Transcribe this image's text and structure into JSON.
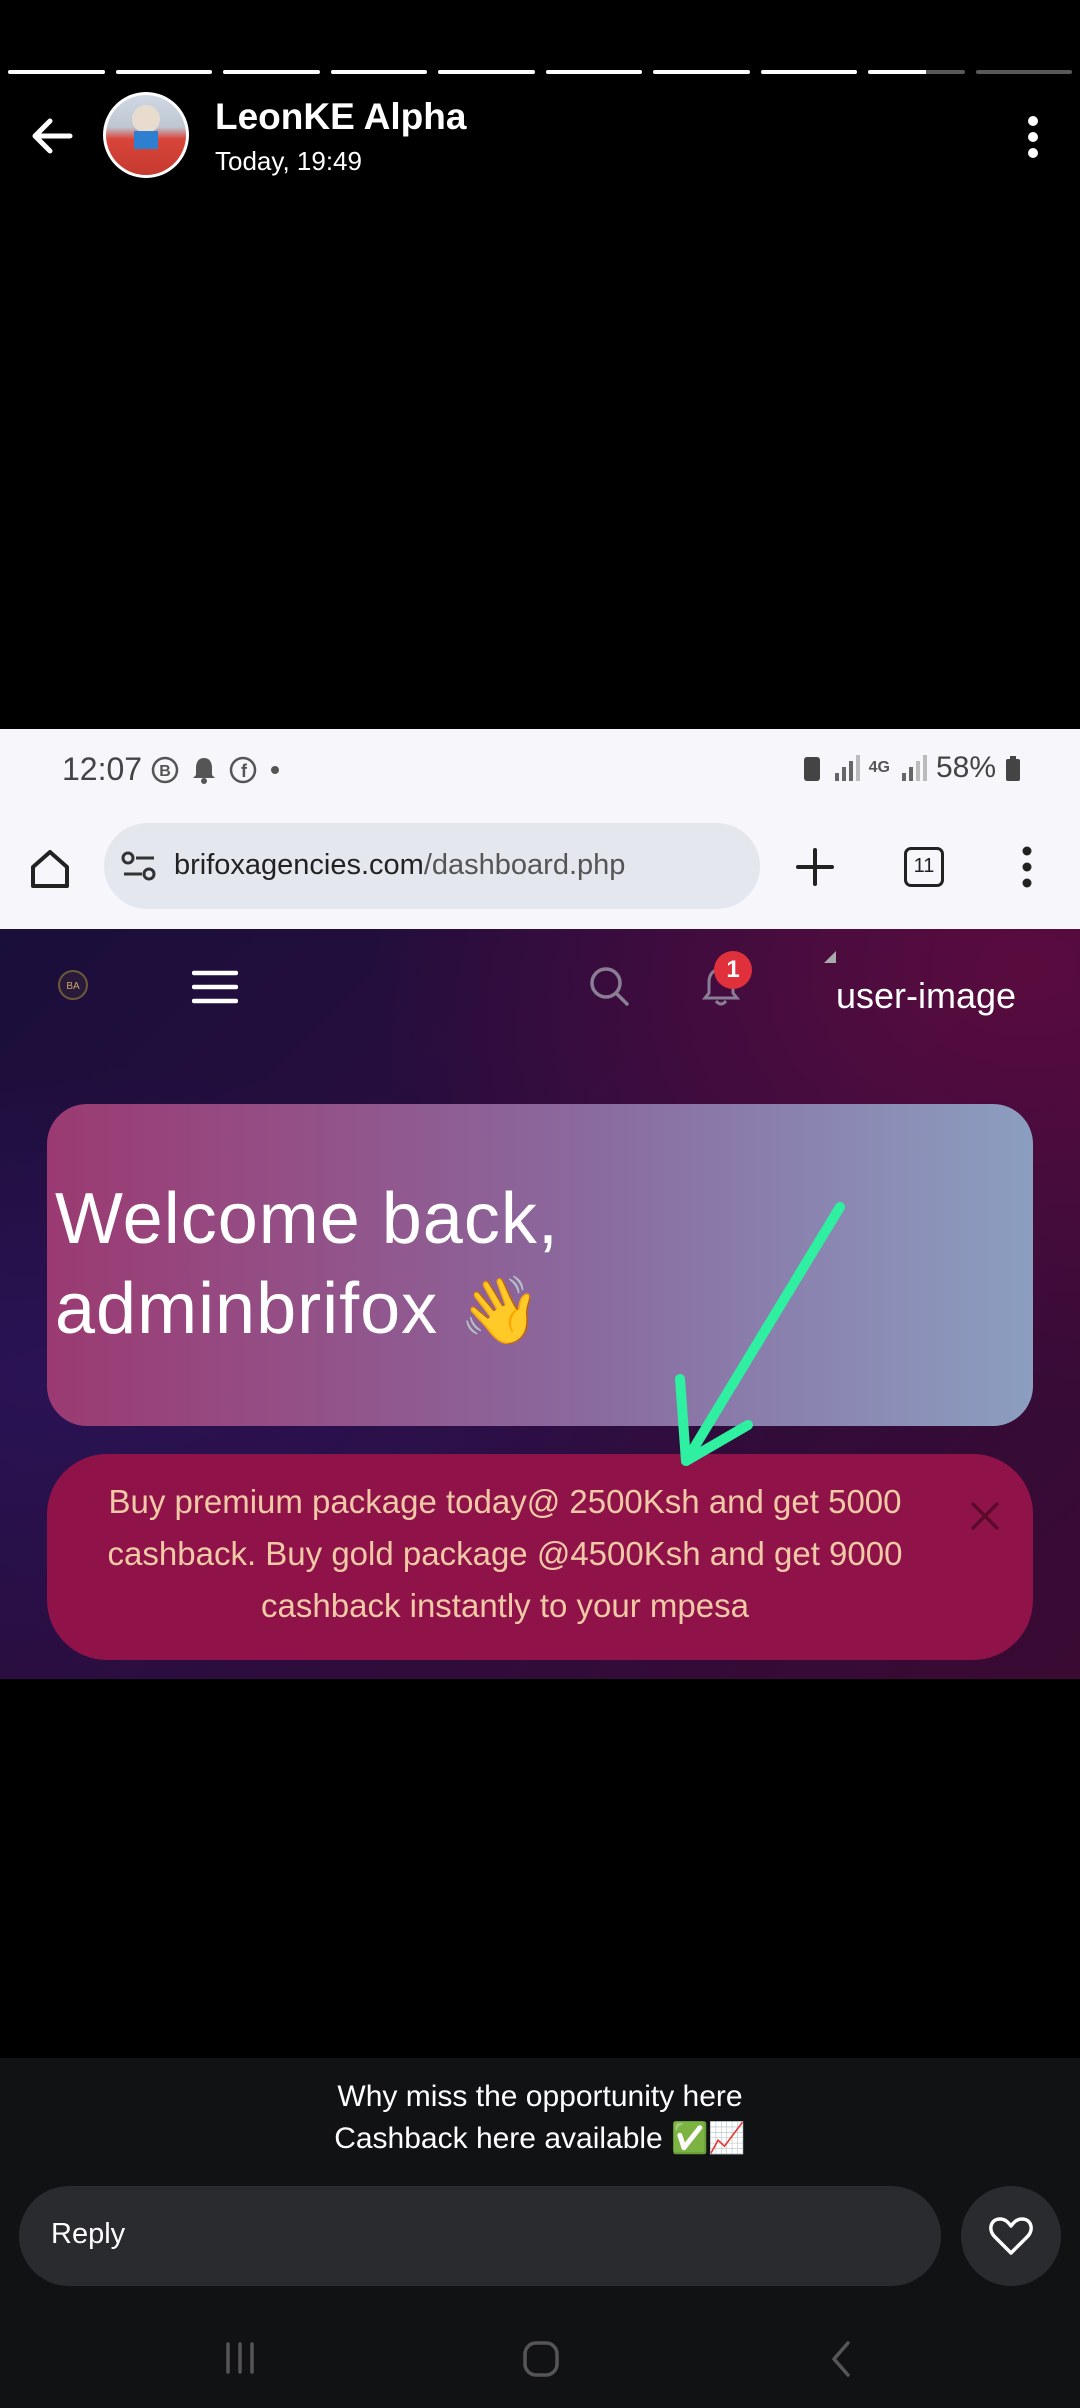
{
  "story": {
    "segments_total": 10,
    "segments_complete": 8,
    "current_segment_progress": 0.6,
    "author_name": "LeonKE Alpha",
    "timestamp": "Today, 19:49",
    "back_icon": "arrow-left-icon",
    "menu_icon": "more-vert-icon"
  },
  "status_bar": {
    "time": "12:07",
    "network": "4G",
    "battery": "58%"
  },
  "browser": {
    "url_domain": "brifoxagencies.com",
    "url_path": "/dashboard.php",
    "tab_count": "11"
  },
  "site": {
    "notification_count": "1",
    "user_image_alt": "user-image",
    "welcome_line1": "Welcome back,",
    "welcome_line2": "adminbrifox",
    "wave_emoji": "👋",
    "promo_text": "Buy premium package today@ 2500Ksh and get 5000 cashback. Buy gold package @4500Ksh and get 9000 cashback instantly to your mpesa",
    "arrow_color": "#2ef0a0"
  },
  "caption": {
    "line1": "Why miss the opportunity here",
    "line2": "Cashback here  available ✅📈"
  },
  "reply": {
    "placeholder": "Reply"
  },
  "colors": {
    "promo_bg": "#8f1249",
    "promo_text": "#f0c9a6",
    "badge": "#e0303b"
  }
}
